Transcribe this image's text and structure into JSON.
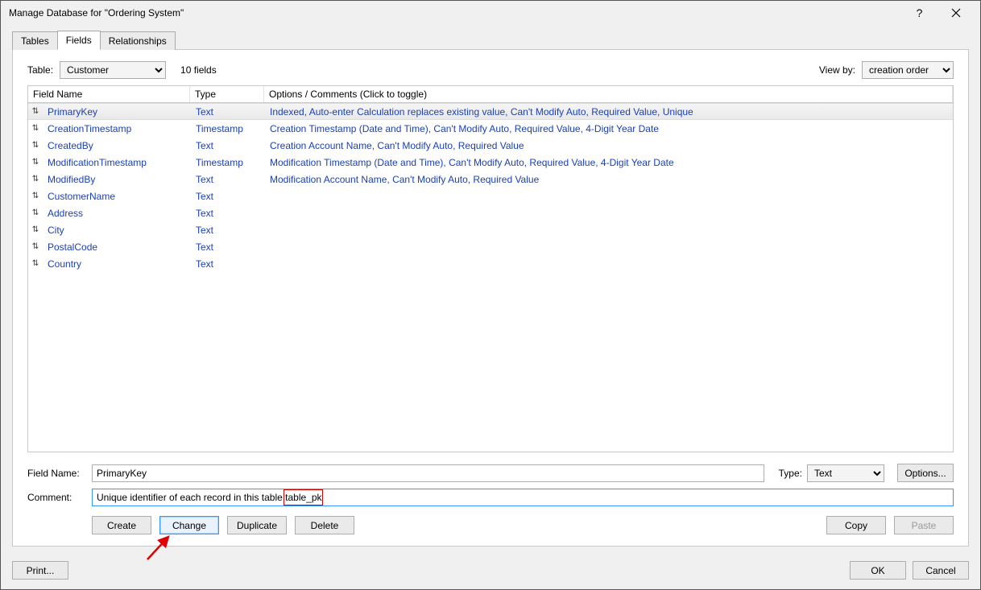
{
  "window": {
    "title": "Manage Database for \"Ordering System\""
  },
  "tabs": [
    "Tables",
    "Fields",
    "Relationships"
  ],
  "active_tab_index": 1,
  "toolbar": {
    "table_label": "Table:",
    "table_value": "Customer",
    "count_text": "10 fields",
    "viewby_label": "View by:",
    "viewby_value": "creation order"
  },
  "grid": {
    "headers": {
      "name": "Field Name",
      "type": "Type",
      "options": "Options / Comments   (Click to toggle)"
    },
    "rows": [
      {
        "name": "PrimaryKey",
        "type": "Text",
        "options": "Indexed, Auto-enter Calculation replaces existing value, Can't Modify Auto, Required Value, Unique",
        "selected": true
      },
      {
        "name": "CreationTimestamp",
        "type": "Timestamp",
        "options": "Creation Timestamp (Date and Time), Can't Modify Auto, Required Value, 4-Digit Year Date"
      },
      {
        "name": "CreatedBy",
        "type": "Text",
        "options": "Creation Account Name, Can't Modify Auto, Required Value"
      },
      {
        "name": "ModificationTimestamp",
        "type": "Timestamp",
        "options": "Modification Timestamp (Date and Time), Can't Modify Auto, Required Value, 4-Digit Year Date"
      },
      {
        "name": "ModifiedBy",
        "type": "Text",
        "options": "Modification Account Name, Can't Modify Auto, Required Value"
      },
      {
        "name": "CustomerName",
        "type": "Text",
        "options": ""
      },
      {
        "name": "Address",
        "type": "Text",
        "options": ""
      },
      {
        "name": "City",
        "type": "Text",
        "options": ""
      },
      {
        "name": "PostalCode",
        "type": "Text",
        "options": ""
      },
      {
        "name": "Country",
        "type": "Text",
        "options": ""
      }
    ]
  },
  "form": {
    "fieldname_label": "Field Name:",
    "fieldname_value": "PrimaryKey",
    "type_label": "Type:",
    "type_value": "Text",
    "options_btn": "Options...",
    "comment_label": "Comment:",
    "comment_value": "Unique identifier of each record in this table table_pk"
  },
  "actions": {
    "create": "Create",
    "change": "Change",
    "duplicate": "Duplicate",
    "delete": "Delete",
    "copy": "Copy",
    "paste": "Paste"
  },
  "bottom": {
    "print": "Print...",
    "ok": "OK",
    "cancel": "Cancel"
  }
}
